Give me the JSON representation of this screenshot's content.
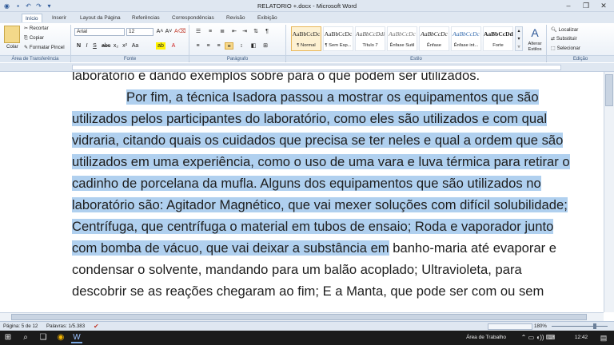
{
  "window": {
    "title": "RELATORIO +.docx - Microsoft Word"
  },
  "tabs": [
    "Início",
    "Inserir",
    "Layout da Página",
    "Referências",
    "Correspondências",
    "Revisão",
    "Exibição"
  ],
  "clipboard": {
    "paste_label": "Colar",
    "cut_label": "Recortar",
    "copy_label": "Copiar",
    "format_painter_label": "Formatar Pincel",
    "group_label": "Área de Transferência"
  },
  "font": {
    "family": "Arial",
    "size": "12",
    "group_label": "Fonte"
  },
  "paragraph": {
    "group_label": "Parágrafo"
  },
  "styles": {
    "group_label": "Estilo",
    "items": [
      {
        "preview": "AaBbCcDc",
        "name": "¶ Normal"
      },
      {
        "preview": "AaBbCcDc",
        "name": "¶ Sem Esp..."
      },
      {
        "preview": "AaBbCcDdi",
        "name": "Título 7"
      },
      {
        "preview": "AaBbCcDc",
        "name": "Ênfase Sutil"
      },
      {
        "preview": "AaBbCcDc",
        "name": "Ênfase"
      },
      {
        "preview": "AaBbCcDc",
        "name": "Ênfase int..."
      },
      {
        "preview": "AaBbCcDd",
        "name": "Forte"
      }
    ],
    "change_label": "Alterar Estilos"
  },
  "editing": {
    "find_label": "Localizar",
    "replace_label": "Substituir",
    "select_label": "Selecionar",
    "group_label": "Edição"
  },
  "document": {
    "lines": [
      {
        "pre": "laboratório e dando exemplos sobre para o que podem ser utilizados.",
        "sel": ""
      },
      {
        "pre": "",
        "sel": "Por fim, a técnica Isadora passou a mostrar os equipamentos que são"
      },
      {
        "pre": "",
        "sel": "utilizados pelos participantes do laboratório, como eles são utilizados e com qual"
      },
      {
        "pre": "",
        "sel": "vidraria, citando quais os cuidados que precisa se ter neles e qual a ordem que são"
      },
      {
        "pre": "",
        "sel": "utilizados em uma experiência, como o uso de uma vara e luva térmica para retirar o"
      },
      {
        "pre": "",
        "sel": "cadinho de porcelana da mufla. Alguns dos equipamentos que são utilizados no"
      },
      {
        "pre": "",
        "sel": "laboratório são: Agitador Magnético, que vai mexer soluções com difícil solubilidade;"
      },
      {
        "pre": "",
        "sel": "Centrífuga, que centrífuga o material em tubos de ensaio; Roda e vaporador junto"
      },
      {
        "pre": "",
        "sel": "com bomba de vácuo, que vai deixar a substância em",
        "post": " banho-maria até evaporar e"
      },
      {
        "pre": "condensar o solvente, mandando para um balão acoplado; Ultravioleta, para",
        "sel": ""
      },
      {
        "pre": "descobrir se as reações chegaram ao fim; E a Manta, que pode ser com ou sem",
        "sel": ""
      }
    ]
  },
  "status": {
    "page": "Página: 5 de 12",
    "words": "Palavras: 1/5.383",
    "zoom": "180%"
  },
  "taskbar": {
    "tray_label": "Área de Trabalho",
    "time": "12:42"
  }
}
